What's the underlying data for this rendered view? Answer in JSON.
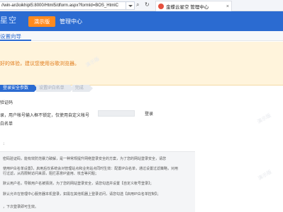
{
  "browser": {
    "address": "//win-an3oikhipl5:8000/Html5/dform.aspx?formId=BOS_HtmlC",
    "tab_title": "金蝶云星空 管理中心",
    "tab_close": "×"
  },
  "header": {
    "brand": "星空",
    "demo_button": "演示版",
    "nav_link": "管理中心"
  },
  "subbar": {
    "title": "设置向导"
  },
  "warning": {
    "text": "好的体验，建议您使用谷歌浏览器。"
  },
  "steps": [
    {
      "label": "登录安全参数",
      "state": "active"
    },
    {
      "label": "设置IP白名单",
      "state": "inactive"
    },
    {
      "label": "完成",
      "state": "inactive"
    }
  ],
  "options": {
    "opt1": "验证码",
    "opt2": "录，用户帐号输入框不锁定，仅使用自定义帐号",
    "opt2_link": "登录",
    "opt3": "白名单"
  },
  "help": {
    "heading": "：",
    "lines": [
      "密码验证码，能有效防范暴力破解，是一种常规提升网络登录安全的方案，为了您的网站登录安全，请您",
      "",
      "使用IP白名单设置】，启用后仅系统会对管理站点和业务站点同时生效：配置IP白名单，通过设置过滤策略，对用",
      "行过滤，从而限制访问来源，阻拦恶意IP盗用、攻击等问题；",
      "",
      "默认用户名，导致用户名被猜测，为了您的网站登录安全，请您勾选并设置【自定义帐号登录】；",
      "",
      "默认允许在管理中心服务器本机登录，如需在其他机器上登录访问，请您勾选【启用IP白名单控制】；",
      "",
      "，下次登录即可生效。"
    ]
  },
  "watermark": "演示版",
  "colors": {
    "header_blue": "#2b6bd1",
    "demo_orange": "#ff8a1e",
    "warning_bg": "#fff4dc",
    "warning_text": "#e07b1a"
  }
}
